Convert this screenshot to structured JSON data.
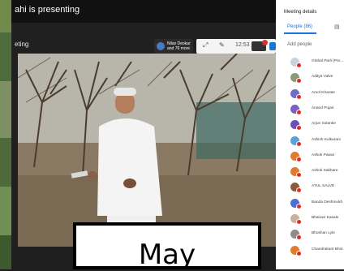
{
  "top_bar": {
    "presenting_text": "ahi is presenting"
  },
  "presentation": {
    "overlay_title": "eting",
    "speaker_chip_name": "Nilav Deokar and 76 more",
    "clock": "12:53"
  },
  "caption": {
    "text": "May"
  },
  "panel": {
    "heading": "Meeting details",
    "tab_people_label": "People (86)",
    "add_people_label": "Add people",
    "participants": [
      {
        "name": "Global Parli (Pre...",
        "avatar_color": "#c9d3da"
      },
      {
        "name": "Aditya Valve",
        "avatar_color": "#8a9a7a"
      },
      {
        "name": "Amol Kharate",
        "avatar_color": "#6b6fc7"
      },
      {
        "name": "Anand Pujari",
        "avatar_color": "#7a5fc0"
      },
      {
        "name": "Arjun Solanke",
        "avatar_color": "#6a4fb5"
      },
      {
        "name": "Ashish Kulkarani",
        "avatar_color": "#5aa0d9"
      },
      {
        "name": "Ashok Pawar",
        "avatar_color": "#e07a2f"
      },
      {
        "name": "Ashok Sakhare",
        "avatar_color": "#e07a2f"
      },
      {
        "name": "ATUL SALVE",
        "avatar_color": "#8b5a3c"
      },
      {
        "name": "Banda Deshmukh",
        "avatar_color": "#4c6fd1"
      },
      {
        "name": "Bhairavi Kasale",
        "avatar_color": "#c9b09a"
      },
      {
        "name": "Bhushan Lyle",
        "avatar_color": "#8c8c8c"
      },
      {
        "name": "Chandrakant Bhol...",
        "avatar_color": "#e07a2f"
      }
    ]
  }
}
